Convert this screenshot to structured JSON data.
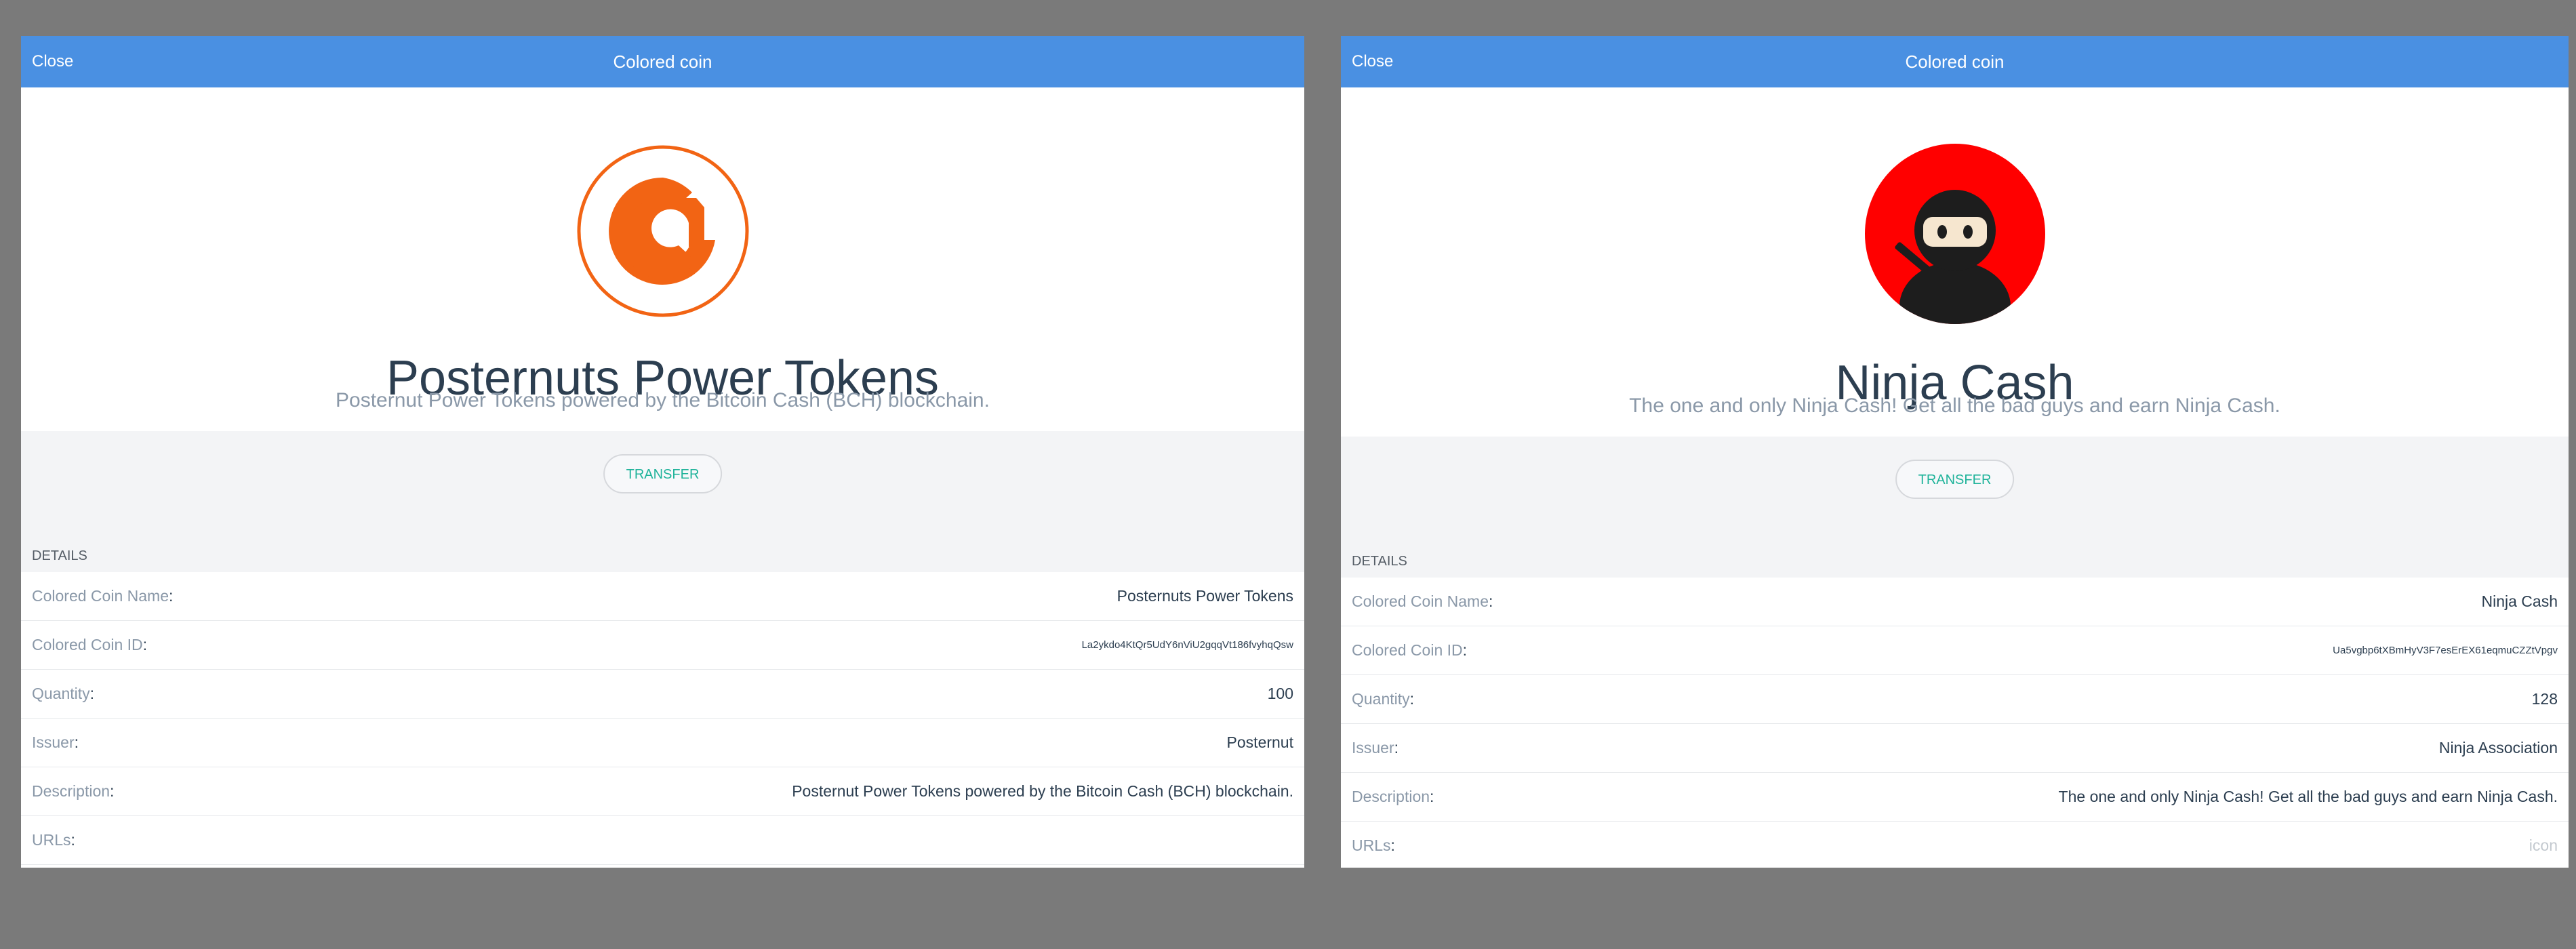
{
  "colors": {
    "header_bar": "#4a90e2",
    "backdrop": "#7a7a7a",
    "accent_transfer": "#1fb39a",
    "posternuts_orange": "#f26414",
    "ninja_red": "#ff0000"
  },
  "panels": [
    {
      "header": {
        "close_label": "Close",
        "title": "Colored coin"
      },
      "logo_icon": "posternuts-logo-icon",
      "title": "Posternuts Power Tokens",
      "subtitle": "Posternut Power Tokens powered by the Bitcoin Cash (BCH) blockchain.",
      "transfer_label": "TRANSFER",
      "details_label": "DETAILS",
      "details": [
        {
          "label": "Colored Coin Name",
          "value": "Posternuts Power Tokens"
        },
        {
          "label": "Colored Coin ID",
          "value": "La2ykdo4KtQr5UdY6nViU2gqqVt186fvyhqQsw"
        },
        {
          "label": "Quantity",
          "value": "100"
        },
        {
          "label": "Issuer",
          "value": "Posternut"
        },
        {
          "label": "Description",
          "value": "Posternut Power Tokens powered by the Bitcoin Cash (BCH) blockchain."
        },
        {
          "label": "URLs",
          "value": ""
        }
      ]
    },
    {
      "header": {
        "close_label": "Close",
        "title": "Colored coin"
      },
      "logo_icon": "ninja-logo-icon",
      "title": "Ninja Cash",
      "subtitle": "The one and only Ninja Cash! Get all the bad guys and earn Ninja Cash.",
      "transfer_label": "TRANSFER",
      "details_label": "DETAILS",
      "details": [
        {
          "label": "Colored Coin Name",
          "value": "Ninja Cash"
        },
        {
          "label": "Colored Coin ID",
          "value": "Ua5vgbp6tXBmHyV3F7esErEX61eqmuCZZtVpgv"
        },
        {
          "label": "Quantity",
          "value": "128"
        },
        {
          "label": "Issuer",
          "value": "Ninja Association"
        },
        {
          "label": "Description",
          "value": "The one and only Ninja Cash! Get all the bad guys and earn Ninja Cash."
        },
        {
          "label": "URLs",
          "value": "icon"
        }
      ]
    }
  ]
}
